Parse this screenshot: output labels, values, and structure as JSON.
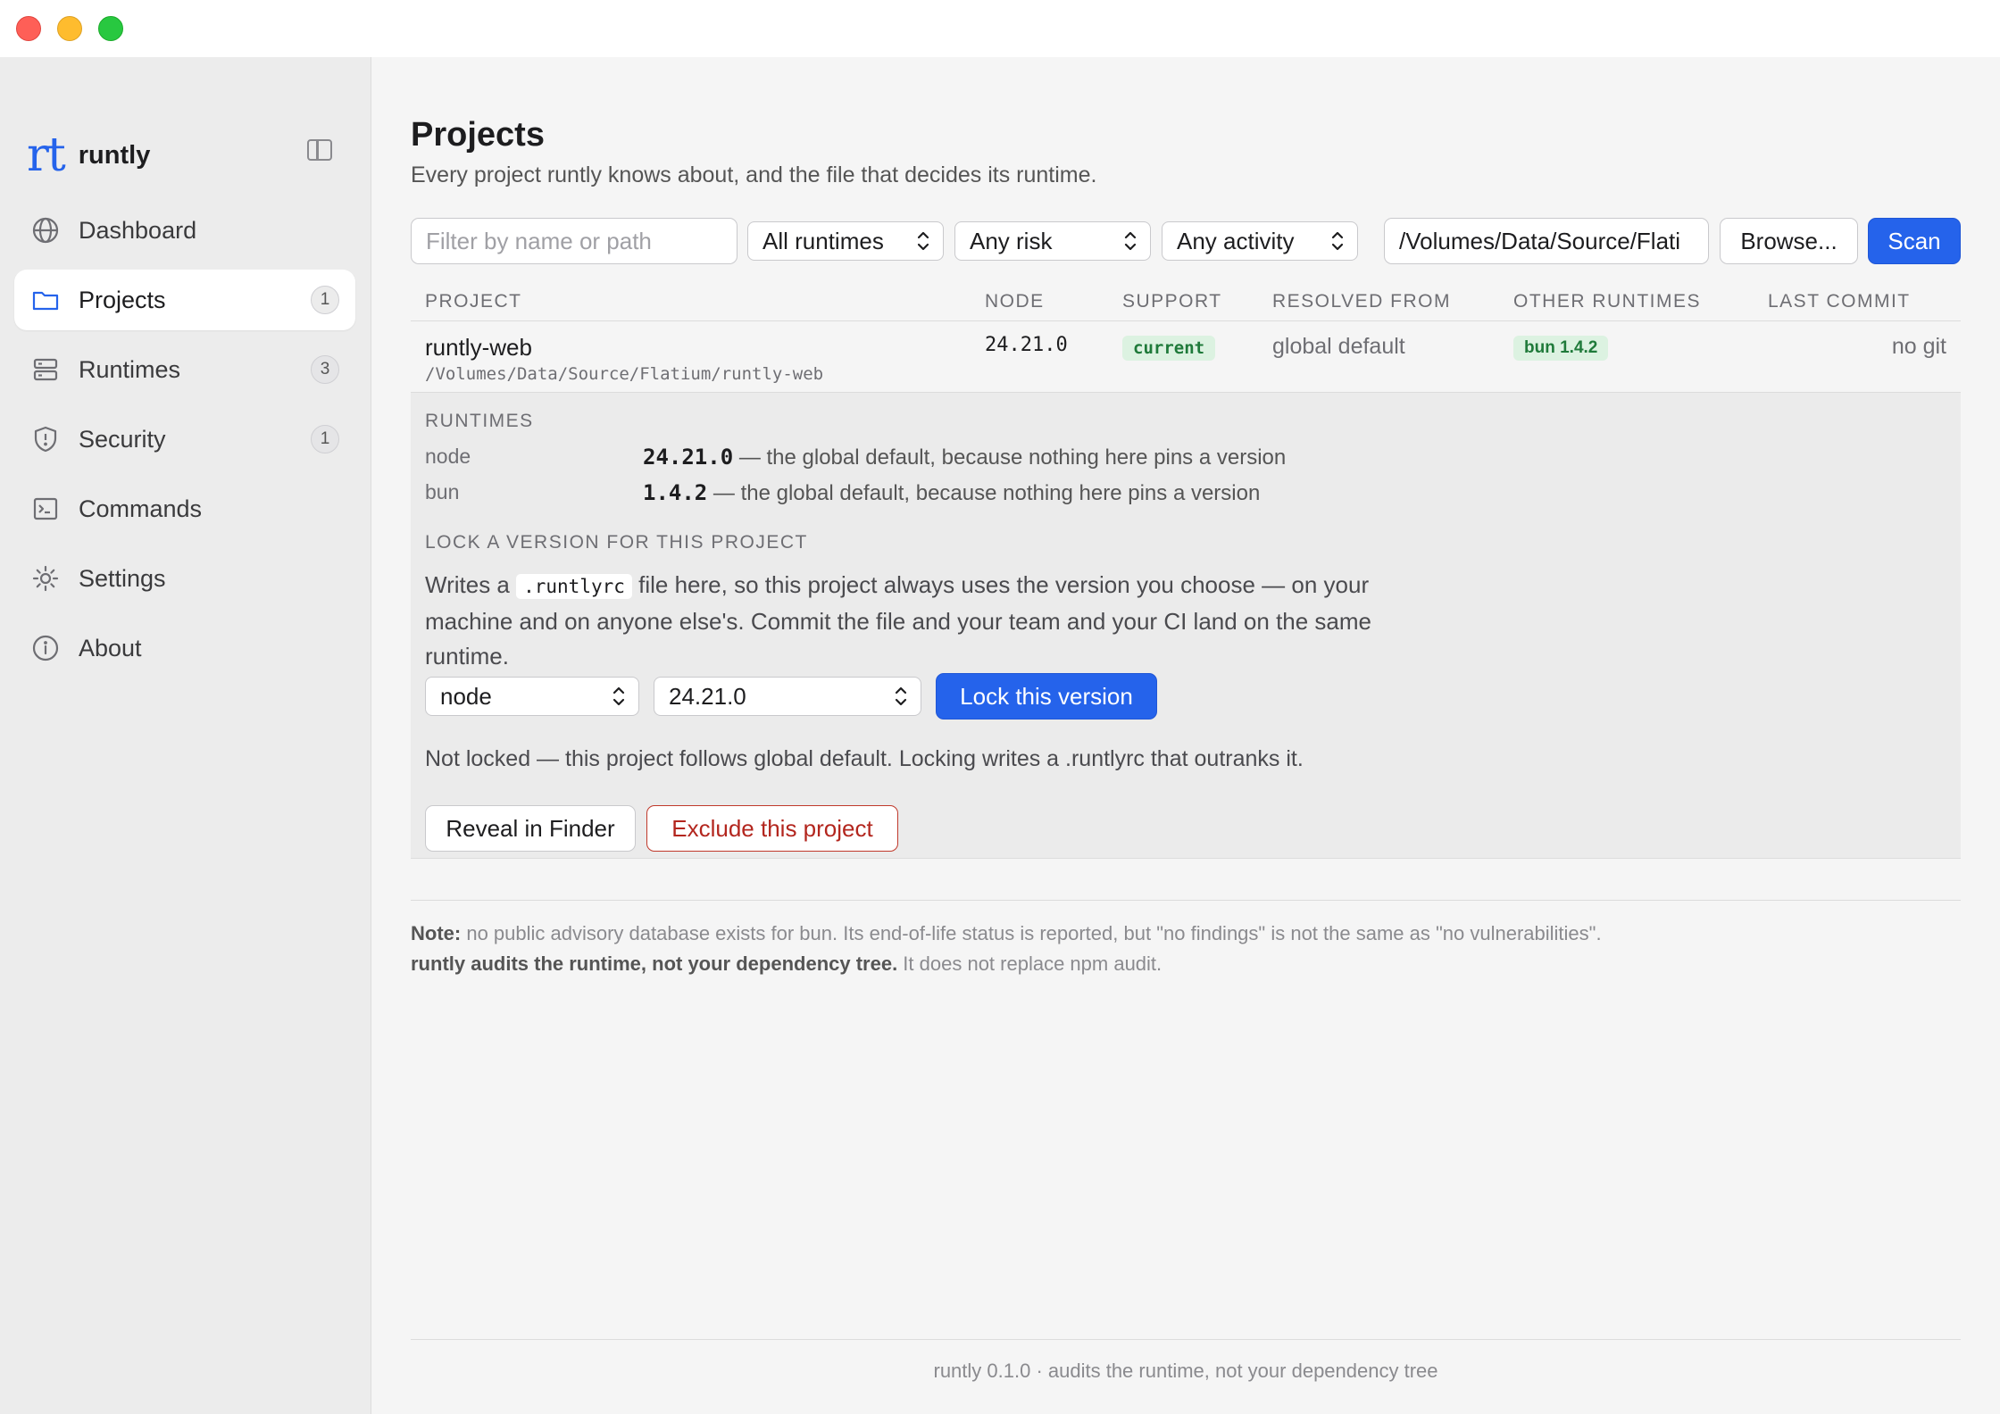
{
  "window": {
    "controls": [
      "close",
      "minimize",
      "zoom"
    ]
  },
  "sidebar": {
    "brand_logo": "rt",
    "brand_name": "runtly",
    "items": [
      {
        "label": "Dashboard",
        "icon": "globe-icon",
        "badge": null,
        "active": false
      },
      {
        "label": "Projects",
        "icon": "folder-icon",
        "badge": "1",
        "active": true
      },
      {
        "label": "Runtimes",
        "icon": "server-icon",
        "badge": "3",
        "active": false
      },
      {
        "label": "Security",
        "icon": "shield-icon",
        "badge": "1",
        "active": false
      },
      {
        "label": "Commands",
        "icon": "terminal-icon",
        "badge": null,
        "active": false
      },
      {
        "label": "Settings",
        "icon": "sun-gear-icon",
        "badge": null,
        "active": false
      },
      {
        "label": "About",
        "icon": "info-icon",
        "badge": null,
        "active": false
      }
    ]
  },
  "header": {
    "title": "Projects",
    "subtitle": "Every project runtly knows about, and the file that decides its runtime."
  },
  "toolbar": {
    "filter_placeholder": "Filter by name or path",
    "runtime_select": "All runtimes",
    "risk_select": "Any risk",
    "activity_select": "Any activity",
    "path_value": "/Volumes/Data/Source/Flati",
    "browse_label": "Browse...",
    "scan_label": "Scan"
  },
  "table": {
    "columns": [
      "PROJECT",
      "NODE",
      "SUPPORT",
      "RESOLVED FROM",
      "OTHER RUNTIMES",
      "LAST COMMIT"
    ],
    "rows": [
      {
        "name": "runtly-web",
        "path": "/Volumes/Data/Source/Flatium/runtly-web",
        "node": "24.21.0",
        "support": "current",
        "resolved_from": "global default",
        "other_runtimes": "bun 1.4.2",
        "last_commit": "no git"
      }
    ]
  },
  "detail": {
    "runtimes_heading": "RUNTIMES",
    "runtimes": [
      {
        "name": "node",
        "version": "24.21.0",
        "note": " — the global default, because nothing here pins a version"
      },
      {
        "name": "bun",
        "version": "1.4.2",
        "note": " — the global default, because nothing here pins a version"
      }
    ],
    "lock_heading": "LOCK A VERSION FOR THIS PROJECT",
    "lock_text_before": "Writes a ",
    "lock_file": ".runtlyrc",
    "lock_text_after": " file here, so this project always uses the version you choose — on your machine and on anyone else's. Commit the file and your team and your CI land on the same runtime.",
    "runtime_choice": "node",
    "version_choice": "24.21.0",
    "lock_button": "Lock this version",
    "status": "Not locked — this project follows global default. Locking writes a .runtlyrc that outranks it.",
    "reveal_button": "Reveal in Finder",
    "exclude_button": "Exclude this project"
  },
  "note": {
    "label": "Note:",
    "text": " no public advisory database exists for bun. Its end-of-life status is reported, but \"no findings\" is not the same as \"no vulnerabilities\".",
    "bold2": "runtly audits the runtime, not your dependency tree.",
    "text2": " It does not replace npm audit."
  },
  "footer": {
    "text": "runtly 0.1.0 · audits the runtime, not your dependency tree"
  },
  "colors": {
    "accent": "#2563eb",
    "danger": "#b3261e",
    "success_bg": "#dcf2e1",
    "success_fg": "#1f7a3a"
  }
}
